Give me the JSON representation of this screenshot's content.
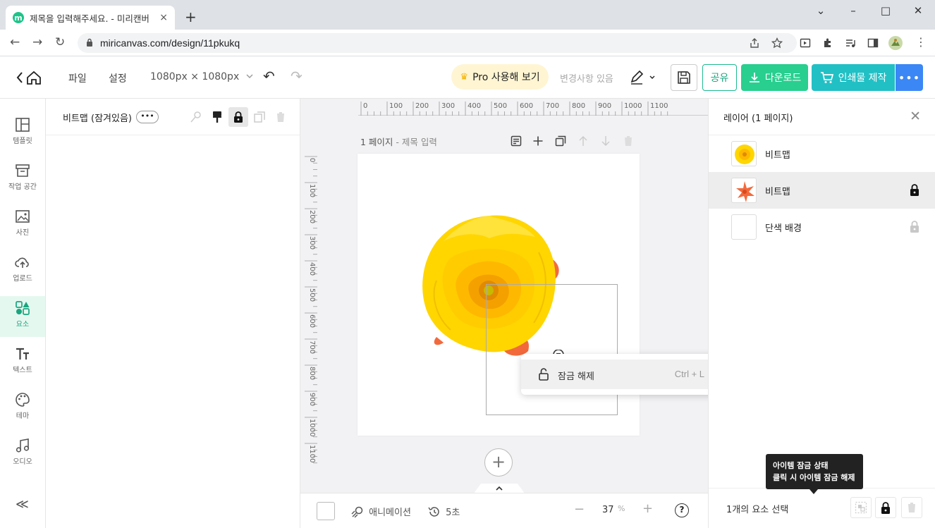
{
  "browser": {
    "tab_title": "제목을 입력해주세요. - 미리캔버",
    "favicon_letter": "m",
    "tab_close": "×",
    "new_tab": "+",
    "url": "miricanvas.com/design/11pkukq",
    "window_controls": {
      "minimize": "–",
      "maximize": "□",
      "close": "✕",
      "tab_list": "⌄"
    },
    "nav": {
      "back": "←",
      "forward": "→",
      "reload": "↻"
    }
  },
  "header": {
    "file": "파일",
    "settings": "설정",
    "size": "1080px × 1080px",
    "pro_label": "Pro 사용해 보기",
    "pro_icon": "♛",
    "changes_status": "변경사항 있음",
    "share": "공유",
    "download": "다운로드",
    "print": "인쇄물 제작",
    "more": "•••",
    "undo": "↶",
    "redo": "↷"
  },
  "leftnav": {
    "items": [
      {
        "label": "템플릿",
        "icon": "template-icon"
      },
      {
        "label": "작업 공간",
        "icon": "workspace-icon"
      },
      {
        "label": "사진",
        "icon": "photo-icon"
      },
      {
        "label": "업로드",
        "icon": "upload-icon"
      },
      {
        "label": "요소",
        "icon": "elements-icon",
        "active": true
      },
      {
        "label": "텍스트",
        "icon": "text-icon"
      },
      {
        "label": "테마",
        "icon": "palette-icon"
      },
      {
        "label": "오디오",
        "icon": "music-icon"
      }
    ],
    "collapse": "≪"
  },
  "property_panel": {
    "title": "비트맵 (잠겨있음)",
    "more": "•••"
  },
  "canvas": {
    "page_label": "1 페이지",
    "page_title_placeholder": "- 제목 입력",
    "ruler_top": [
      "0",
      "100",
      "200",
      "300",
      "400",
      "500",
      "600",
      "700",
      "800",
      "900",
      "1000",
      "1100"
    ],
    "ruler_left": [
      "0",
      "100",
      "200",
      "300",
      "400",
      "500",
      "600",
      "700",
      "800",
      "900",
      "1000",
      "1100"
    ],
    "add_page": "+",
    "expand": "^"
  },
  "context_menu": {
    "unlock_label": "잠금 해제",
    "unlock_shortcut": "Ctrl + L"
  },
  "bottombar": {
    "animation": "애니메이션",
    "history": "5초",
    "zoom_minus": "−",
    "zoom_value": "37",
    "zoom_unit": "%",
    "zoom_plus": "+",
    "help": "?"
  },
  "layer_panel": {
    "title": "레이어 (1 페이지)",
    "close": "✕",
    "layers": [
      {
        "name": "비트맵",
        "locked": false
      },
      {
        "name": "비트맵",
        "locked": true,
        "selected": true
      },
      {
        "name": "단색 배경",
        "locked": true
      }
    ],
    "selection_count": "1개의 요소 선택"
  },
  "tooltip": {
    "line1": "아이템 잠금 상태",
    "line2": "클릭 시 아이템 잠금 해제"
  },
  "colors": {
    "accent_green": "#28cf8f",
    "print_teal": "#21c0c5",
    "more_blue": "#3b87f5",
    "flower_yellow": "#ffd600",
    "flower_orange": "#f26a3c"
  }
}
